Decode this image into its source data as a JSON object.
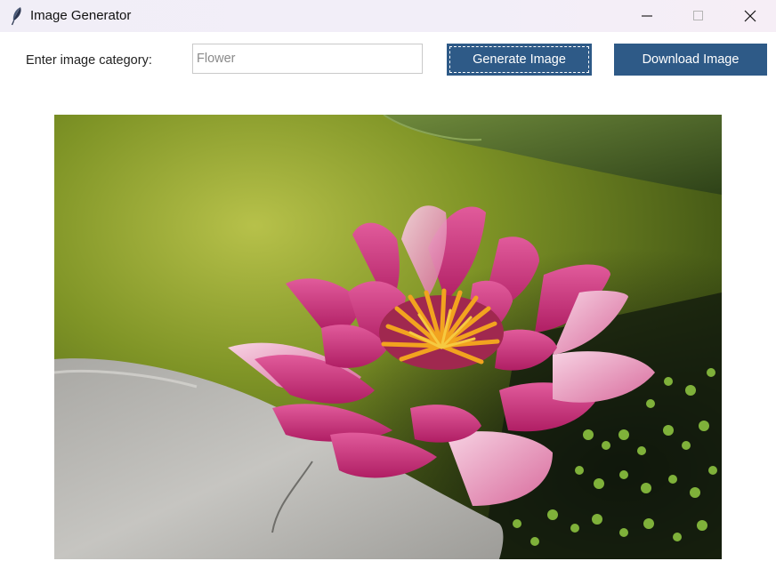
{
  "window": {
    "title": "Image Generator",
    "app_icon": "feather-icon",
    "controls": [
      "minimize-icon",
      "maximize-icon",
      "close-icon"
    ]
  },
  "form": {
    "category_label": "Enter image category:",
    "category_value": "",
    "category_placeholder": "Flower",
    "generate_label": "Generate Image",
    "download_label": "Download Image"
  },
  "image": {
    "subject": "pink water lily on a pond with duckweed beside a gray rock"
  },
  "colors": {
    "button_bg": "#2e5a87",
    "button_text": "#ffffff",
    "titlebar_bg": "#f1eef7"
  }
}
